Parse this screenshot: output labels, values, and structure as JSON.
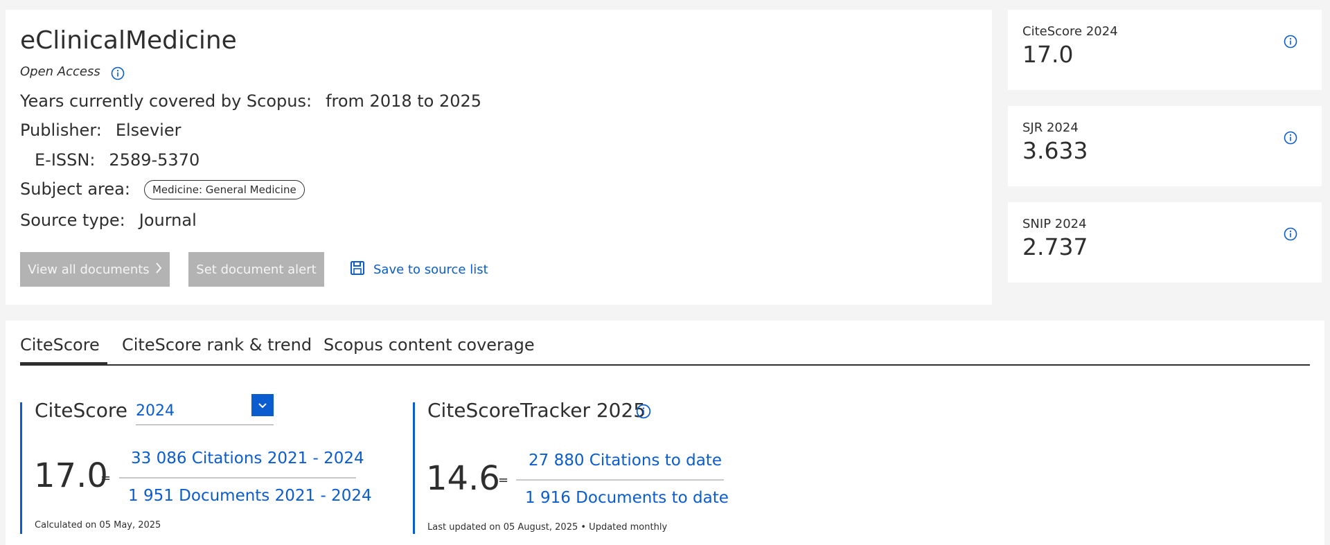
{
  "source": {
    "title": "eClinicalMedicine",
    "open_access": "Open Access",
    "years_label": "Years currently covered by Scopus:",
    "years_value": "from 2018 to 2025",
    "publisher_label": "Publisher:",
    "publisher_value": "Elsevier",
    "eissn_label": "E-ISSN:",
    "eissn_value": "2589-5370",
    "subject_label": "Subject area:",
    "subject_value": "Medicine: General Medicine",
    "source_type_label": "Source type:",
    "source_type_value": "Journal"
  },
  "actions": {
    "view_all": "View all documents",
    "set_alert": "Set document alert",
    "save_to_list": "Save to source list"
  },
  "metrics": [
    {
      "label": "CiteScore 2024",
      "value": "17.0"
    },
    {
      "label": "SJR 2024",
      "value": "3.633"
    },
    {
      "label": "SNIP 2024",
      "value": "2.737"
    }
  ],
  "tabs": [
    {
      "label": "CiteScore",
      "active": true
    },
    {
      "label": "CiteScore rank & trend",
      "active": false
    },
    {
      "label": "Scopus content coverage",
      "active": false
    }
  ],
  "citescore": {
    "heading": "CiteScore",
    "year": "2024",
    "value": "17.0",
    "equals": "=",
    "citations": "33 086 Citations 2021 - 2024",
    "documents": "1 951 Documents 2021 - 2024",
    "calculated": "Calculated on 05 May, 2025"
  },
  "tracker": {
    "heading": "CiteScoreTracker 2025",
    "value": "14.6",
    "equals": "=",
    "citations": "27 880 Citations to date",
    "documents": "1 916 Documents to date",
    "updated": "Last updated on 05 August, 2025 • Updated monthly"
  },
  "colors": {
    "accent": "#0b5ccf",
    "button_disabled": "#b3b3b3",
    "background": "#f4f4f4"
  },
  "icons": [
    "info-icon",
    "save-icon",
    "chevron-right-icon",
    "chevron-down-icon"
  ]
}
